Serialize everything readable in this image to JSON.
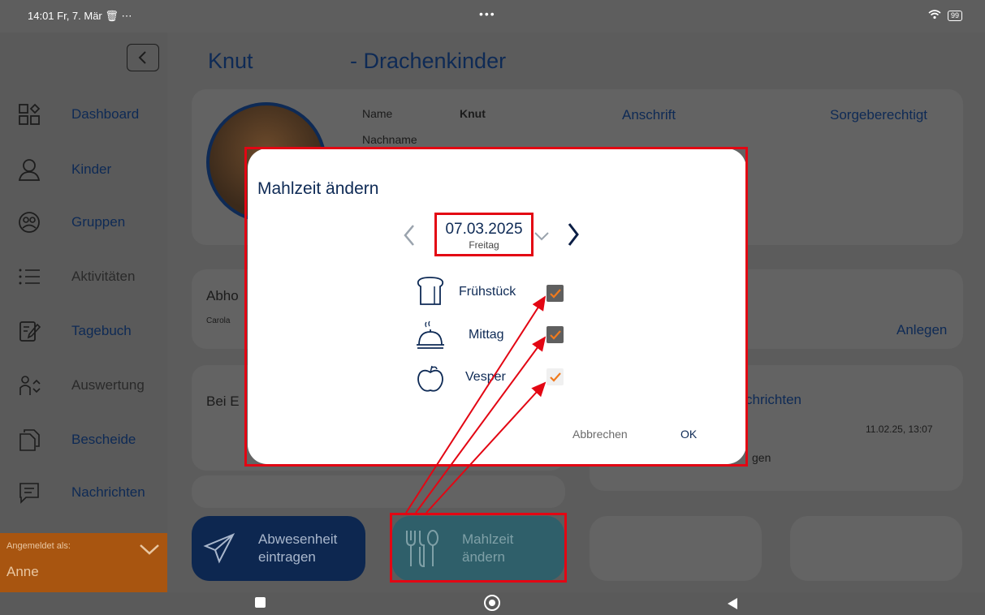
{
  "status_bar": {
    "time_date": "14:01  Fr, 7. Mär",
    "battery": "99"
  },
  "sidebar": {
    "items": [
      {
        "label": "Dashboard"
      },
      {
        "label": "Kinder"
      },
      {
        "label": "Gruppen"
      },
      {
        "label": "Aktivitäten"
      },
      {
        "label": "Tagebuch"
      },
      {
        "label": "Auswertung"
      },
      {
        "label": "Bescheide"
      },
      {
        "label": "Nachrichten"
      }
    ],
    "logged_in_label": "Angemeldet als:",
    "user": "Anne"
  },
  "main": {
    "child_name": "Knut",
    "group": "- Drachenkinder",
    "info": {
      "name_label": "Name",
      "name_value": "Knut",
      "lastname_label": "Nachname"
    },
    "headers": {
      "address": "Anschrift",
      "guardians": "Sorgeberechtigt"
    },
    "pickup_label": "Abho",
    "pickup_person": "Carola",
    "create_link": "Anlegen",
    "emergency_label": "Bei E",
    "messages_header": "chrichten",
    "message_time": "11.02.25, 13:07",
    "message_snippet": "gen",
    "actions": {
      "absence": [
        "Abwesenheit",
        "eintragen"
      ],
      "meal": [
        "Mahlzeit",
        "ändern"
      ]
    }
  },
  "dialog": {
    "title": "Mahlzeit ändern",
    "date": "07.03.2025",
    "weekday": "Freitag",
    "meals": [
      {
        "label": "Frühstück",
        "checked": true
      },
      {
        "label": "Mittag",
        "checked": true
      },
      {
        "label": "Vesper",
        "checked": true
      }
    ],
    "cancel_label": "Abbrechen",
    "ok_label": "OK"
  },
  "colors": {
    "accent_orange": "#f07a1d",
    "navy": "#0e2a55",
    "highlight_red": "#e30613"
  }
}
